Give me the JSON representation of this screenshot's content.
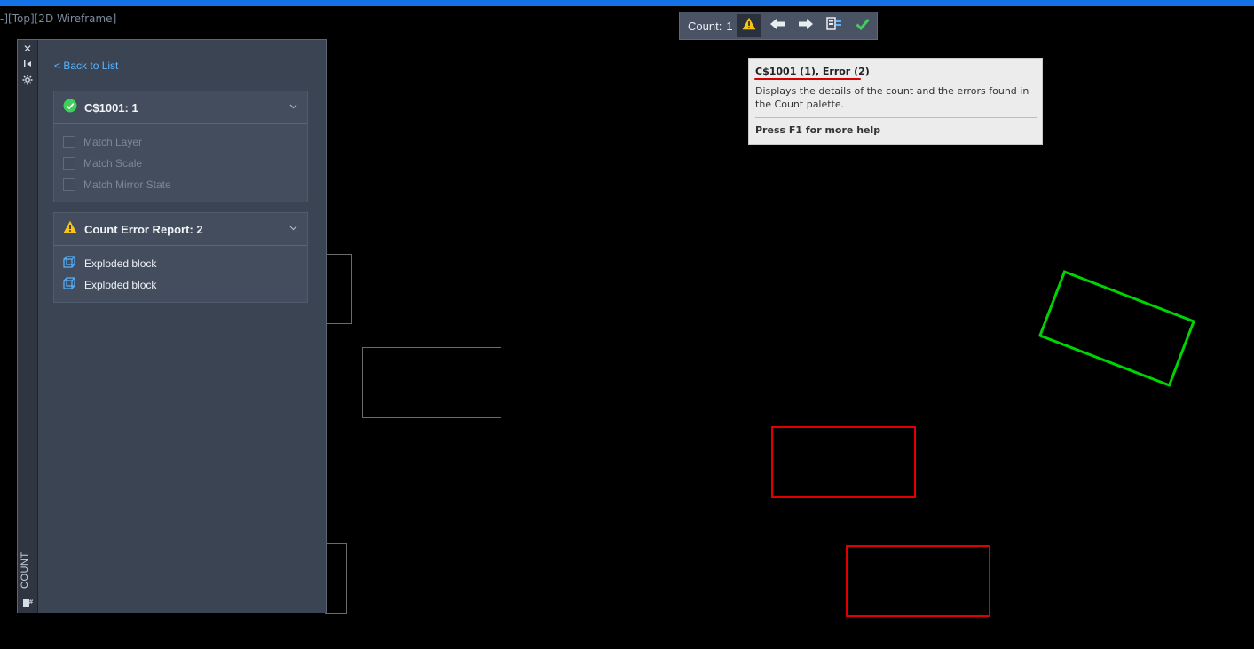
{
  "viewport": {
    "label": "-][Top][2D Wireframe]"
  },
  "palette": {
    "strip": {
      "close": "✕",
      "title": "COUNT"
    },
    "back_link": "< Back to List",
    "block_section": {
      "title": "C$1001: 1",
      "options": [
        {
          "label": "Match Layer"
        },
        {
          "label": "Match Scale"
        },
        {
          "label": "Match Mirror State"
        }
      ]
    },
    "error_section": {
      "title": "Count Error Report: 2",
      "items": [
        {
          "label": "Exploded block"
        },
        {
          "label": "Exploded block"
        }
      ]
    }
  },
  "toolbar": {
    "count_label": "Count:",
    "count_value": "1"
  },
  "tooltip": {
    "title": "C$1001 (1), Error (2)",
    "description": "Displays the details of the count and the errors found in the Count palette.",
    "help": "Press F1 for more help"
  },
  "colors": {
    "accent": "#1473e6",
    "ok_green": "#3fcf5b",
    "warning_yellow": "#f5c518",
    "error_red": "#e10000",
    "link_blue": "#5ab4ff"
  },
  "icons": {
    "close": "close-icon",
    "dock": "dock-icon",
    "settings": "settings-icon",
    "check_circle": "check-circle-icon",
    "warning": "warning-icon",
    "chevron": "chevron-down-icon",
    "block": "block-icon",
    "prev": "arrow-left-icon",
    "next": "arrow-right-icon",
    "table": "insert-table-icon",
    "finish": "checkmark-icon"
  }
}
